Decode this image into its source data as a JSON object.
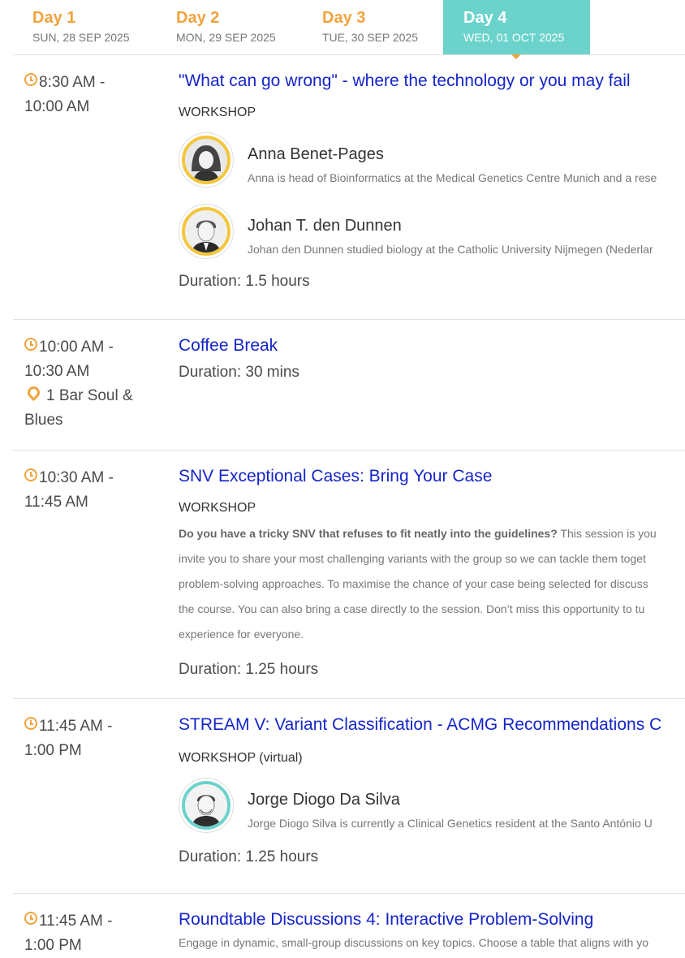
{
  "tabs": [
    {
      "day": "Day 1",
      "date": "SUN, 28 SEP 2025"
    },
    {
      "day": "Day 2",
      "date": "MON, 29 SEP 2025"
    },
    {
      "day": "Day 3",
      "date": "TUE, 30 SEP 2025"
    },
    {
      "day": "Day 4",
      "date": "WED, 01 OCT 2025"
    }
  ],
  "active_tab": "Day 4",
  "colors": {
    "accent": "#f0a33c",
    "active_tab": "#6bd3cb",
    "link": "#1525c9"
  },
  "sessions": [
    {
      "time_start": "8:30 AM -",
      "time_end": "10:00 AM",
      "title": "\"What can go wrong\" - where the technology or you may fail",
      "type": "WORKSHOP",
      "speakers": [
        {
          "name": "Anna Benet-Pages",
          "bio": "Anna is head of Bioinformatics at the Medical Genetics Centre Munich and a rese"
        },
        {
          "name": "Johan T. den Dunnen",
          "bio": "Johan den Dunnen studied biology at the Catholic University Nijmegen (Nederlar"
        }
      ],
      "duration": "Duration: 1.5 hours"
    },
    {
      "time_start": "10:00 AM -",
      "time_end": "10:30 AM",
      "location_line1": "1 Bar Soul &",
      "location_line2": "Blues",
      "title": "Coffee Break",
      "duration": "Duration: 30 mins"
    },
    {
      "time_start": "10:30 AM -",
      "time_end": "11:45 AM",
      "title": "SNV Exceptional Cases: Bring Your Case",
      "type": "WORKSHOP",
      "description": {
        "bold": "Do you have a tricky SNV that refuses to fit neatly into the guidelines?",
        "line1_rest": " This session is you",
        "line2": "invite you to share your most challenging variants with the group so we can tackle them toget",
        "line3": "problem-solving approaches. To maximise the chance of your case being selected for discuss",
        "line4": "the course. You can also bring a case directly to the session. Don’t miss this opportunity to tu",
        "line5": "experience for everyone."
      },
      "duration": "Duration: 1.25 hours"
    },
    {
      "time_start": "11:45 AM -",
      "time_end": "1:00 PM",
      "title": "STREAM V: Variant Classification - ACMG Recommendations C",
      "type": "WORKSHOP",
      "type_suffix": "(virtual)",
      "speakers": [
        {
          "name": "Jorge Diogo Da Silva",
          "bio": "Jorge Diogo Silva is currently a Clinical Genetics resident at the Santo António U"
        }
      ],
      "duration": "Duration: 1.25 hours"
    },
    {
      "time_start": "11:45 AM -",
      "time_end": "1:00 PM",
      "title": "Roundtable Discussions 4: Interactive Problem-Solving",
      "description_line": "Engage in dynamic, small-group discussions on key topics. Choose a table that aligns with yo"
    }
  ]
}
